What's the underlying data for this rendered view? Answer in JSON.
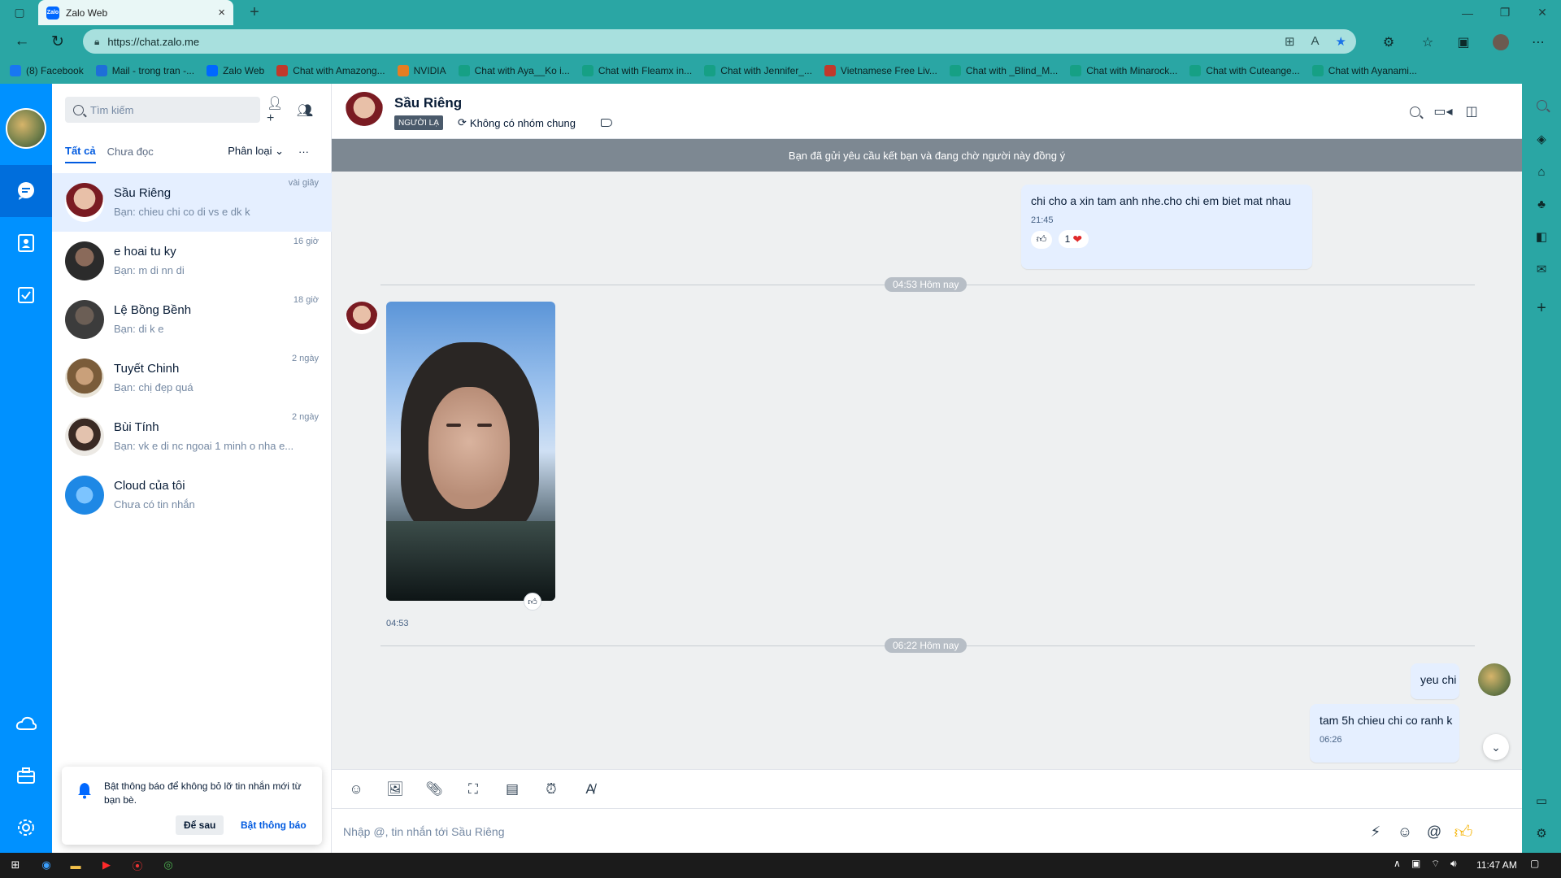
{
  "browser": {
    "tab_title": "Zalo Web",
    "url": "https://chat.zalo.me",
    "bookmarks": [
      {
        "label": "(8) Facebook",
        "color": "#1877f2"
      },
      {
        "label": "Mail - trong tran -...",
        "color": "#1e6fd8"
      },
      {
        "label": "Zalo Web",
        "color": "#0068ff"
      },
      {
        "label": "Chat with Amazong...",
        "color": "#c0392b"
      },
      {
        "label": "NVIDIA",
        "color": "#e67e22"
      },
      {
        "label": "Chat with Aya__Ko i...",
        "color": "#16a085"
      },
      {
        "label": "Chat with Fleamx in...",
        "color": "#16a085"
      },
      {
        "label": "Chat with Jennifer_...",
        "color": "#16a085"
      },
      {
        "label": "Vietnamese Free Liv...",
        "color": "#c0392b"
      },
      {
        "label": "Chat with _Blind_M...",
        "color": "#16a085"
      },
      {
        "label": "Chat with Minarock...",
        "color": "#16a085"
      },
      {
        "label": "Chat with Cuteange...",
        "color": "#16a085"
      },
      {
        "label": "Chat with Ayanami...",
        "color": "#16a085"
      }
    ]
  },
  "sidebar": {
    "search_placeholder": "Tìm kiếm",
    "tabs": [
      "Tất cả",
      "Chưa đọc"
    ],
    "classify_label": "Phân loại",
    "conversations": [
      {
        "name": "Sầu Riêng",
        "preview": "Bạn: chieu chi co di vs e dk k",
        "time": "vài giây",
        "active": true,
        "avatar": "radial-gradient(circle at 50% 40%, #e8c0a8 0 35%, #7a1b22 36% 60%, #ffffff 61%)"
      },
      {
        "name": "e hoai tu ky",
        "preview": "Bạn: m di nn di",
        "time": "16 giờ",
        "avatar": "radial-gradient(circle at 50% 40%, #8a6a5a 0 30%, #2b2b2b 31%)"
      },
      {
        "name": "Lệ Bồng Bềnh",
        "preview": "Bạn: di k e",
        "time": "18 giờ",
        "avatar": "radial-gradient(circle at 50% 40%, #6b5e55 0 30%, #3c3c3c 31%)"
      },
      {
        "name": "Tuyết Chinh",
        "preview": "Bạn: chị đẹp quá",
        "time": "2 ngày",
        "avatar": "radial-gradient(circle at 50% 45%, #c9a07a 0 30%, #7a5c3a 31% 60%, #e9e4d8 61%)"
      },
      {
        "name": "Bùi Tính",
        "preview": "Bạn: vk e di nc ngoai 1 minh o nha e...",
        "time": "2 ngày",
        "avatar": "radial-gradient(circle at 50% 45%, #e3c2ae 0 30%, #3a2a24 31% 55%, #ece9e4 56%)"
      },
      {
        "name": "Cloud của tôi",
        "preview": "Chưa có tin nhắn",
        "time": "",
        "avatar": "radial-gradient(circle at 50% 50%, #7cc4ff 0 30%, #1e88e5 31%)"
      }
    ],
    "notification": {
      "text": "Bật thông báo để không bỏ lỡ tin nhắn mới từ bạn bè.",
      "later": "Để sau",
      "enable": "Bật thông báo"
    }
  },
  "chat": {
    "name": "Sầu Riêng",
    "badge": "NGƯỜI LẠ",
    "group_info": "Không có nhóm chung",
    "pending": "Bạn đã gửi yêu cầu kết bạn và đang chờ người này đồng ý",
    "msg1": {
      "text": "chi cho a xin tam anh nhe.cho chi em biet mat nhau",
      "time": "21:45",
      "reaction_count": "1"
    },
    "divider1": "04:53 Hôm nay",
    "photo_time": "04:53",
    "divider2": "06:22 Hôm nay",
    "msg2": {
      "text": "yeu chi"
    },
    "msg3": {
      "text": "tam 5h chieu chi co ranh k",
      "time": "06:26"
    },
    "composer_placeholder": "Nhập @, tin nhắn tới Sầu Riêng"
  },
  "taskbar": {
    "time": "11:47 AM"
  }
}
